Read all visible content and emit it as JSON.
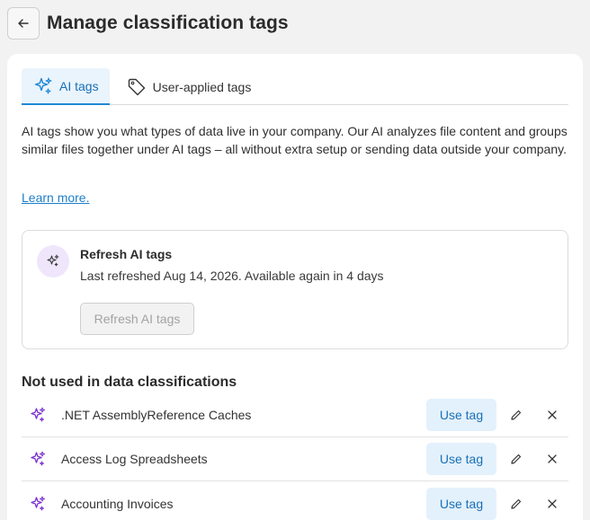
{
  "header": {
    "title": "Manage classification tags",
    "back_icon": "arrow-left-icon"
  },
  "tabs": [
    {
      "label": "AI tags",
      "icon": "sparkle-icon",
      "active": true
    },
    {
      "label": "User-applied tags",
      "icon": "tag-icon",
      "active": false
    }
  ],
  "description": "AI tags show you what types of data live in your company. Our AI analyzes file content and groups similar files together under AI tags – all without extra setup or sending data outside your company.",
  "learn_more": "Learn more.",
  "refresh": {
    "title": "Refresh AI tags",
    "subtitle": "Last refreshed Aug 14, 2026.  Available again in 4 days",
    "button": "Refresh AI tags"
  },
  "section_title": "Not used in data classifications",
  "rows": [
    {
      "label": ".NET AssemblyReference Caches",
      "button": "Use tag"
    },
    {
      "label": "Access Log Spreadsheets",
      "button": "Use tag"
    },
    {
      "label": "Accounting Invoices",
      "button": "Use tag"
    }
  ],
  "colors": {
    "accent": "#1e88d6",
    "ai_purple": "#7b2fd1",
    "background": "#f2f2f2"
  }
}
